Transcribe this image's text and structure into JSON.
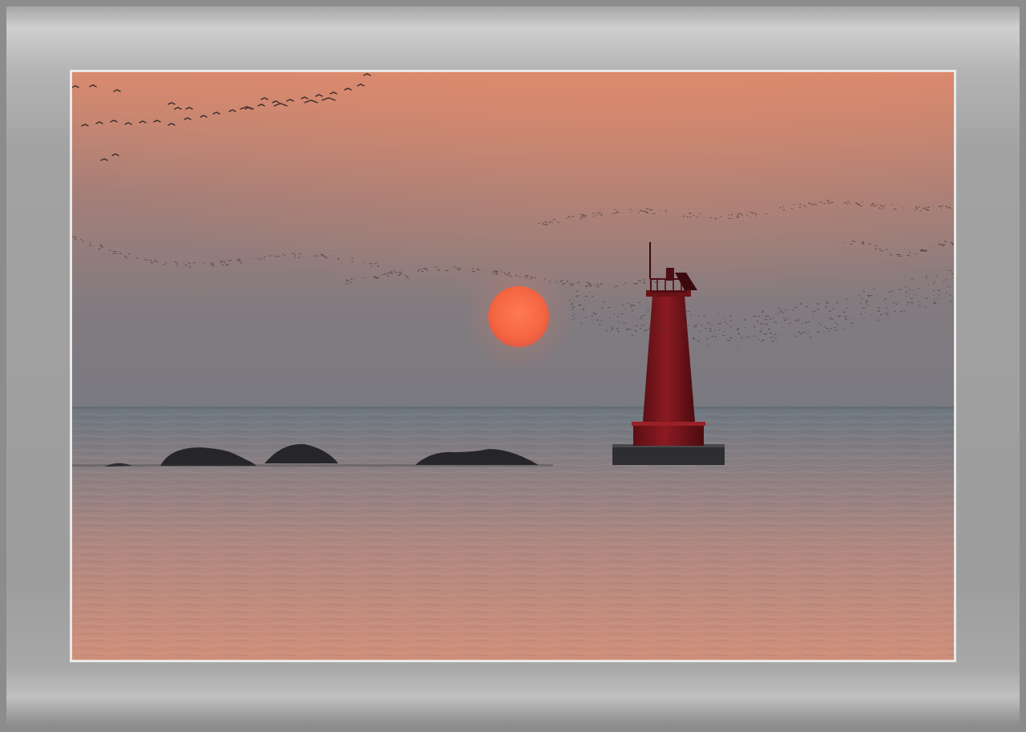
{
  "scene": {
    "subject": "sunset-over-sea-with-red-lighthouse",
    "colors": {
      "sky_top": "#d98a6e",
      "sky_mid": "#9a7e78",
      "sky_horizon": "#7c7a7f",
      "sun": "#f4694a",
      "sea_far": "#707880",
      "sea_near": "#c98c7a",
      "lighthouse": "#8a1820",
      "rocks": "#262628",
      "frame": "#a0a0a0"
    }
  }
}
